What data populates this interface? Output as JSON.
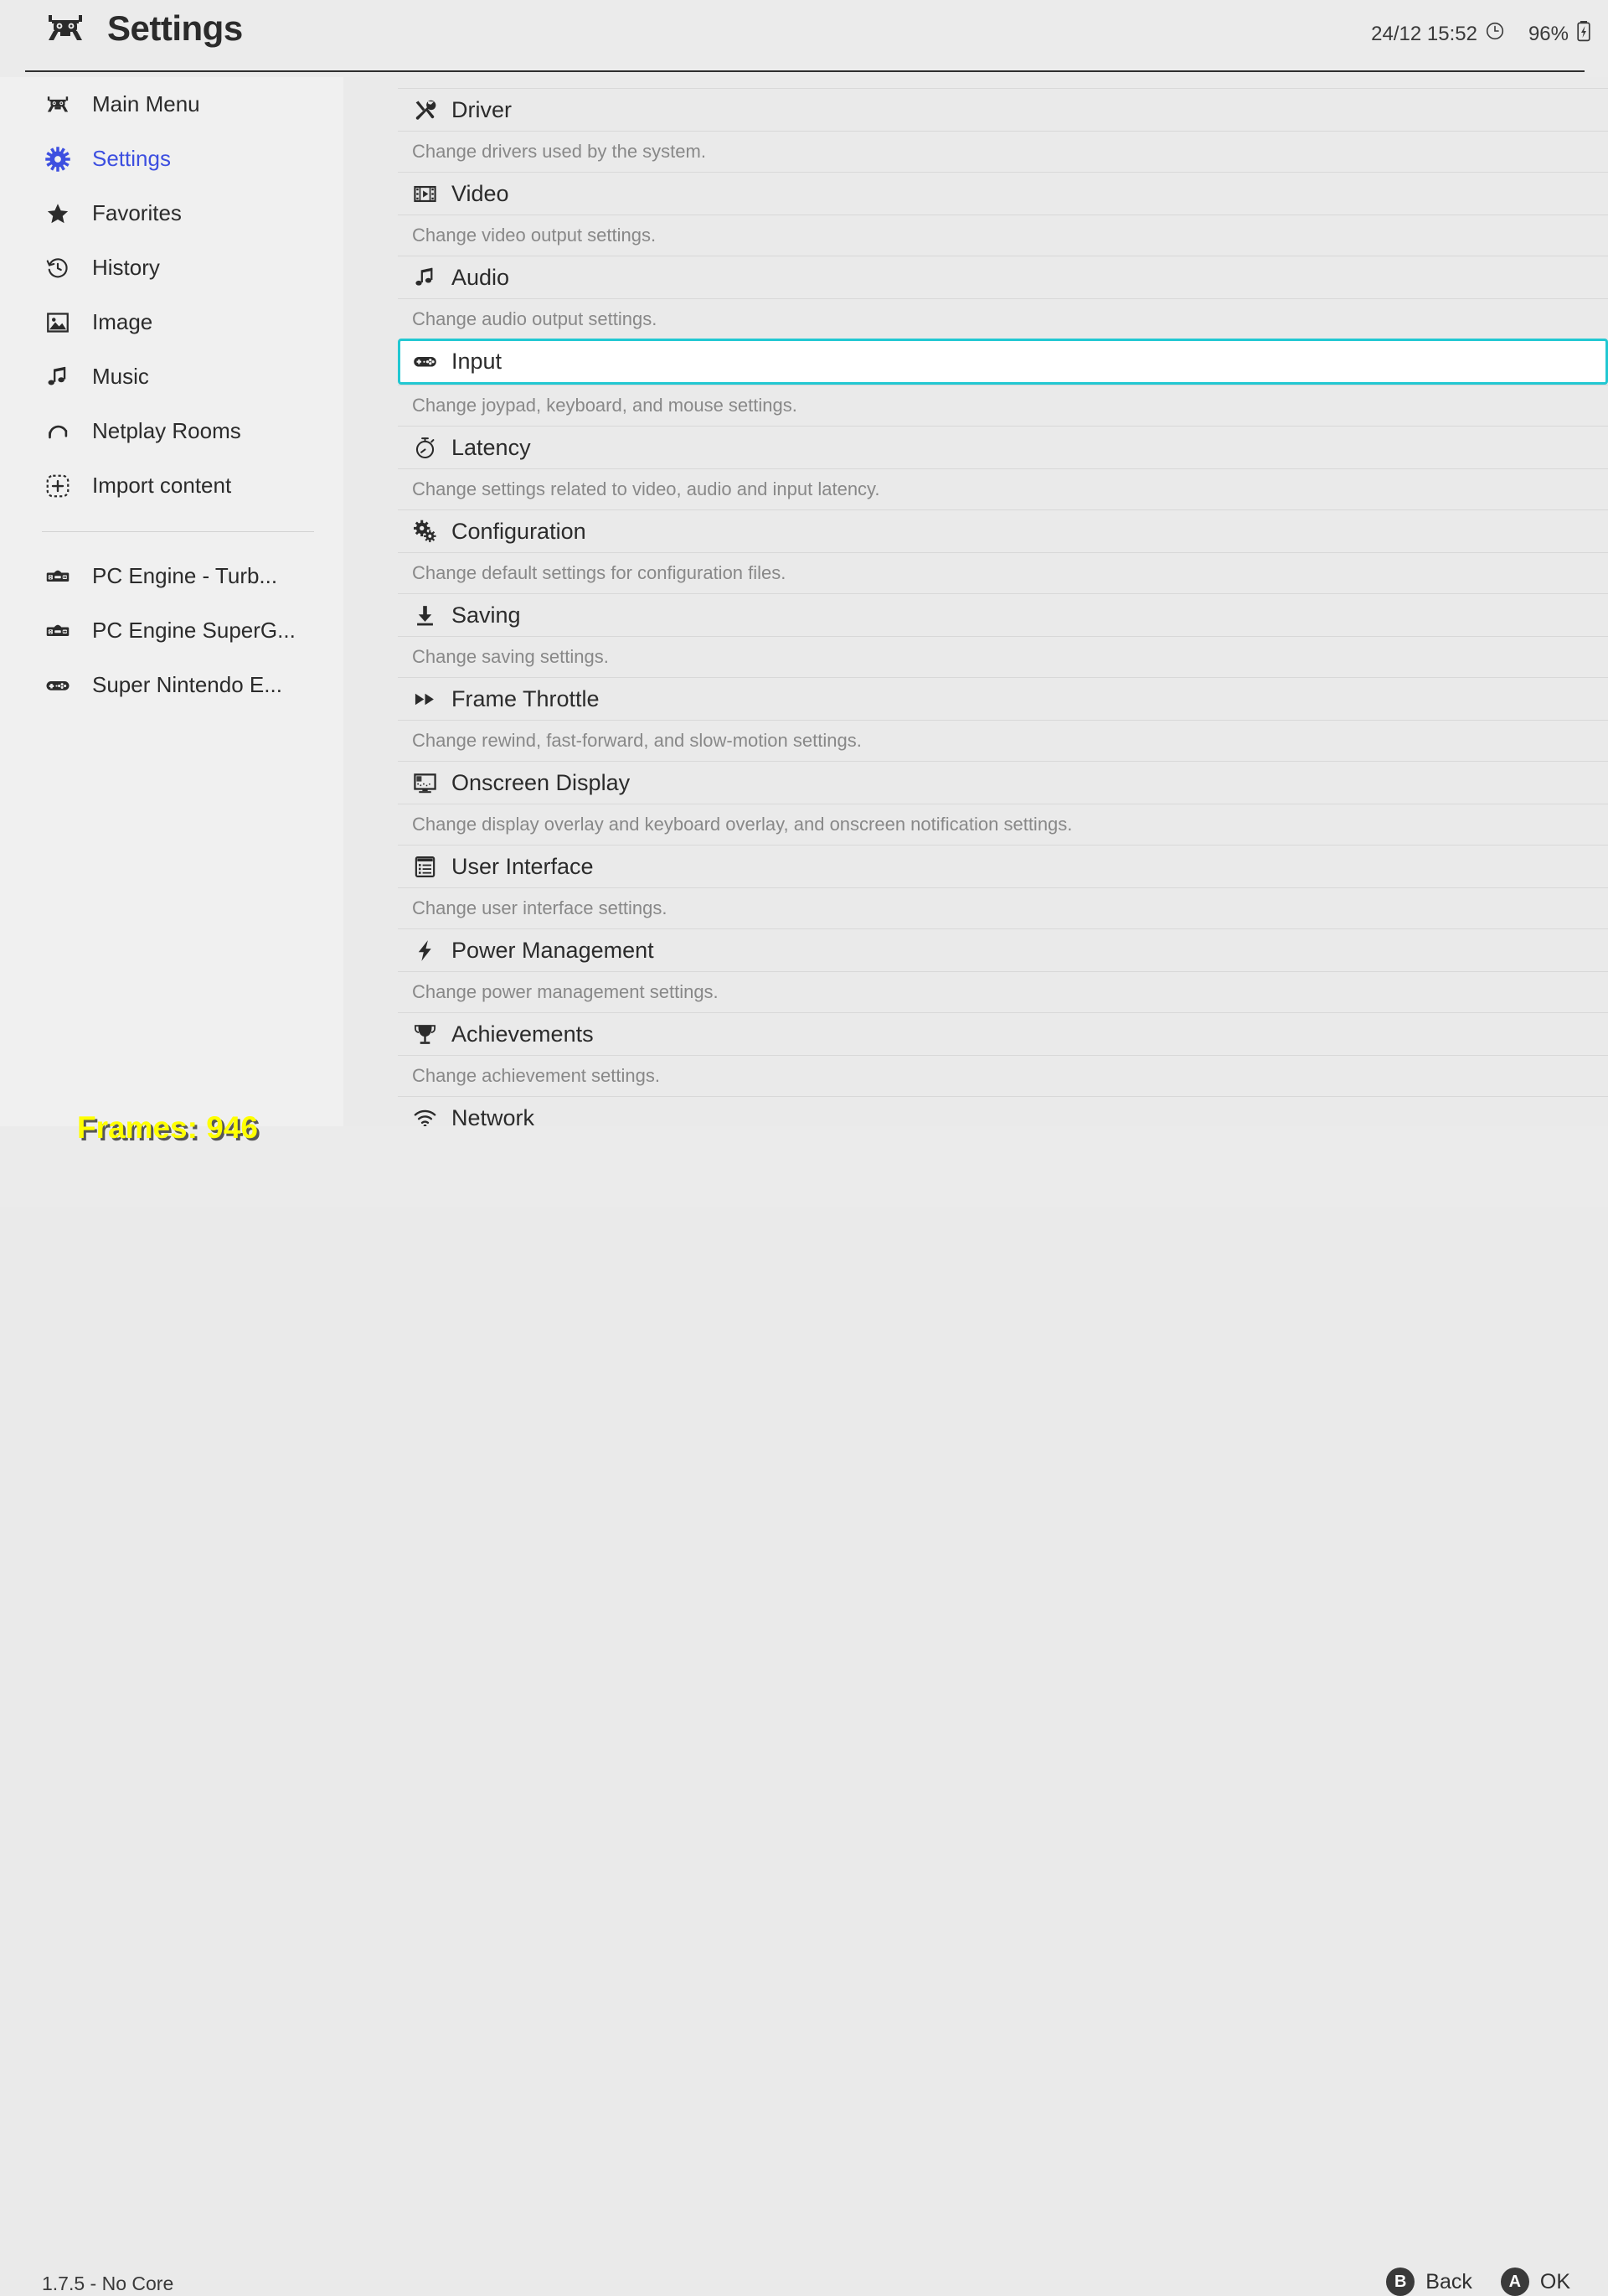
{
  "header": {
    "logo_icon": "retroarch-logo-icon",
    "title": "Settings",
    "datetime": "24/12 15:52",
    "clock_icon": "clock-icon",
    "battery_percent": "96%",
    "battery_icon": "battery-charging-icon"
  },
  "sidebar": {
    "items": [
      {
        "label": "Main Menu",
        "icon": "retroarch-logo-icon",
        "active": false
      },
      {
        "label": "Settings",
        "icon": "gear-icon",
        "active": true
      },
      {
        "label": "Favorites",
        "icon": "star-icon",
        "active": false
      },
      {
        "label": "History",
        "icon": "history-clock-icon",
        "active": false
      },
      {
        "label": "Image",
        "icon": "image-icon",
        "active": false
      },
      {
        "label": "Music",
        "icon": "music-note-icon",
        "active": false
      },
      {
        "label": "Netplay Rooms",
        "icon": "headset-icon",
        "active": false
      },
      {
        "label": "Import content",
        "icon": "plus-dashed-icon",
        "active": false
      }
    ],
    "playlists": [
      {
        "label": "PC Engine - Turb...",
        "icon": "pc-engine-console-icon"
      },
      {
        "label": "PC Engine SuperG...",
        "icon": "pc-engine-console-icon"
      },
      {
        "label": "Super Nintendo E...",
        "icon": "snes-gamepad-icon"
      }
    ]
  },
  "main": {
    "entries": [
      {
        "label": "Driver",
        "icon": "tools-icon",
        "sublabel": "Change drivers used by the system.",
        "selected": false
      },
      {
        "label": "Video",
        "icon": "film-strip-icon",
        "sublabel": "Change video output settings.",
        "selected": false
      },
      {
        "label": "Audio",
        "icon": "music-note-icon",
        "sublabel": "Change audio output settings.",
        "selected": false
      },
      {
        "label": "Input",
        "icon": "gamepad-icon",
        "sublabel": "Change joypad, keyboard, and mouse settings.",
        "selected": true
      },
      {
        "label": "Latency",
        "icon": "stopwatch-icon",
        "sublabel": "Change settings related to video, audio and input latency.",
        "selected": false
      },
      {
        "label": "Configuration",
        "icon": "gears-icon",
        "sublabel": "Change default settings for configuration files.",
        "selected": false
      },
      {
        "label": "Saving",
        "icon": "download-icon",
        "sublabel": "Change saving settings.",
        "selected": false
      },
      {
        "label": "Frame Throttle",
        "icon": "fast-forward-icon",
        "sublabel": "Change rewind, fast-forward, and slow-motion settings.",
        "selected": false
      },
      {
        "label": "Onscreen Display",
        "icon": "monitor-icon",
        "sublabel": "Change display overlay and keyboard overlay, and onscreen notification settings.",
        "selected": false
      },
      {
        "label": "User Interface",
        "icon": "list-panel-icon",
        "sublabel": "Change user interface settings.",
        "selected": false
      },
      {
        "label": "Power Management",
        "icon": "lightning-bolt-icon",
        "sublabel": "Change power management settings.",
        "selected": false
      },
      {
        "label": "Achievements",
        "icon": "trophy-icon",
        "sublabel": "Change achievement settings.",
        "selected": false
      },
      {
        "label": "Network",
        "icon": "wifi-icon",
        "sublabel": "",
        "selected": false
      }
    ]
  },
  "overlay": {
    "frames_counter": "Frames: 946"
  },
  "footer": {
    "version": "1.7.5 - No Core",
    "actions": [
      {
        "badge": "B",
        "label": "Back"
      },
      {
        "badge": "A",
        "label": "OK"
      }
    ]
  },
  "colors": {
    "selection_border": "#22c8d2",
    "sidebar_active_text": "#3d4fe0",
    "overlay_text": "#ffff00",
    "background": "#eaeaea",
    "sidebar_background": "#f0f0f0"
  }
}
